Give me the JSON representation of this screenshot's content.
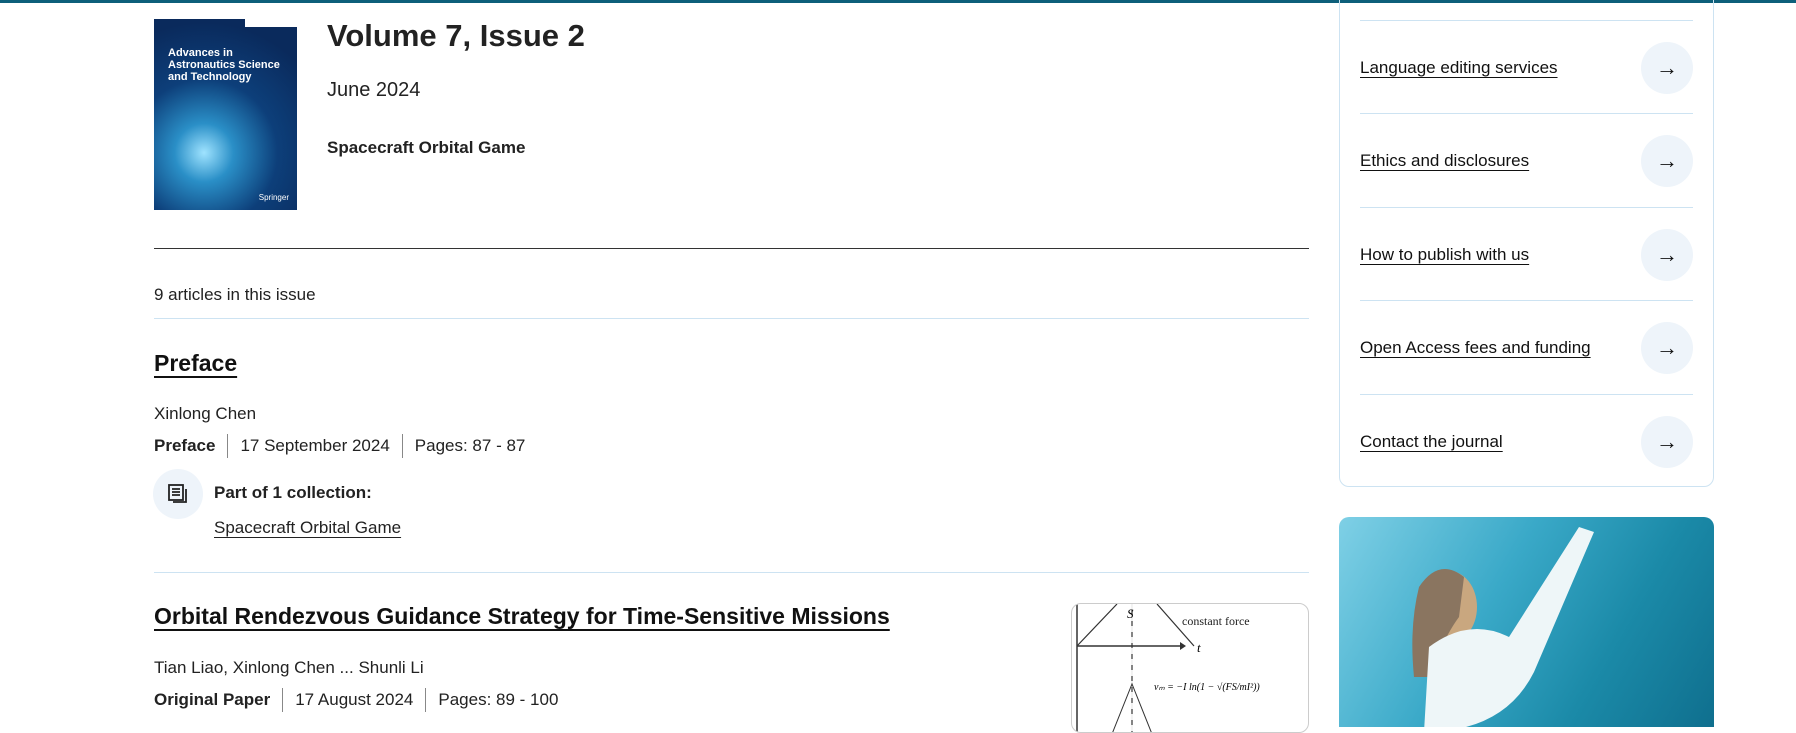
{
  "issue": {
    "title": "Volume 7, Issue 2",
    "date": "June 2024",
    "collection": "Spacecraft Orbital Game",
    "cover_title": "Advances in Astronautics Science and Technology",
    "cover_publisher": "Springer"
  },
  "article_count": "9 articles in this issue",
  "articles": [
    {
      "title": "Preface",
      "authors": "Xinlong Chen",
      "type": "Preface",
      "date": "17 September 2024",
      "pages": "Pages: 87 - 87",
      "collection_label": "Part of 1 collection:",
      "collection_link": "Spacecraft Orbital Game"
    },
    {
      "title": "Orbital Rendezvous Guidance Strategy for Time-Sensitive Missions",
      "authors": "Tian Liao, Xinlong Chen ... Shunli Li",
      "type": "Original Paper",
      "date": "17 August 2024",
      "pages": "Pages: 89 - 100",
      "thumb_text": "constant force"
    }
  ],
  "sidebar": {
    "items": [
      {
        "label": "Language editing services"
      },
      {
        "label": "Ethics and disclosures"
      },
      {
        "label": "How to publish with us"
      },
      {
        "label": "Open Access fees and funding"
      },
      {
        "label": "Contact the journal"
      }
    ]
  },
  "colors": {
    "topbar": "#0d5f7a",
    "divider": "#cde3f2"
  }
}
